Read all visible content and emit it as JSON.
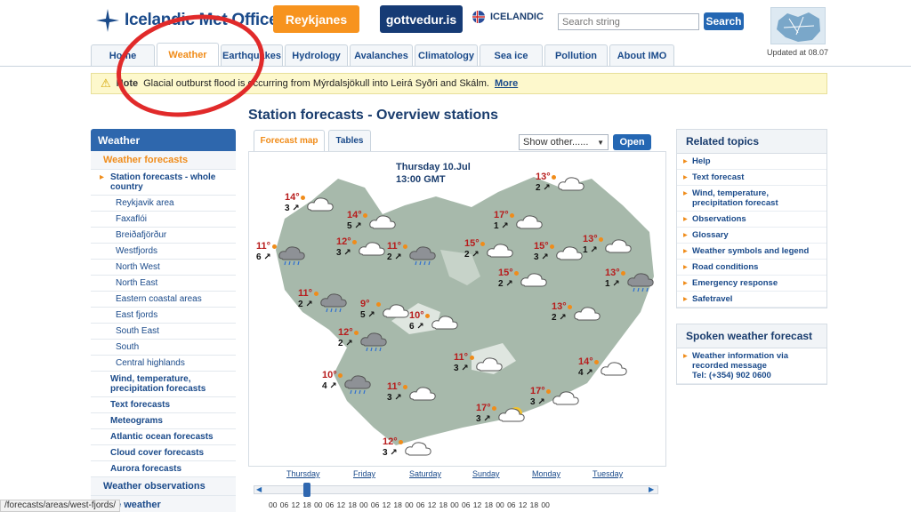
{
  "header": {
    "logo_text": "Icelandic Met Office",
    "btn_reykjanes": "Reykjanes",
    "btn_gottvedur": "gottvedur.is",
    "language": "ICELANDIC",
    "search_placeholder": "Search string",
    "search_button": "Search",
    "updated": "Updated at 08.07"
  },
  "nav": {
    "tabs": [
      "Home",
      "Weather",
      "Earthquakes",
      "Hydrology",
      "Avalanches",
      "Climatology",
      "Sea ice",
      "Pollution",
      "About IMO"
    ],
    "active": "Weather"
  },
  "alert": {
    "label": "Note",
    "text": "Glacial outburst flood is occurring from Mýrdalsjökull into Leirá Syðri and Skálm.",
    "link": "More"
  },
  "sidebar": {
    "head": "Weather",
    "section": "Weather forecasts",
    "first": "Station forecasts - whole country",
    "subs": [
      "Reykjavik area",
      "Faxaflói",
      "Breiðafjörður",
      "Westfjords",
      "North West",
      "North East",
      "Eastern coastal areas",
      "East fjords",
      "South East",
      "South",
      "Central highlands"
    ],
    "items": [
      "Wind, temperature, precipitation forecasts",
      "Text forecasts",
      "Meteograms",
      "Atlantic ocean forecasts",
      "Cloud cover forecasts",
      "Aurora forecasts"
    ],
    "observations": "Weather observations",
    "marine": "rine weather"
  },
  "main": {
    "title": "Station forecasts - Overview stations",
    "tab_map": "Forecast map",
    "tab_tables": "Tables",
    "select_value": "Show other......",
    "open_button": "Open",
    "date_line1": "Thursday 10.Jul",
    "date_line2": "13:00 GMT"
  },
  "stations": [
    {
      "t": "14°",
      "w": "3",
      "sym": "cloud"
    },
    {
      "t": "14°",
      "w": "5",
      "sym": "cloud"
    },
    {
      "t": "11°",
      "w": "6",
      "sym": "rain"
    },
    {
      "t": "12°",
      "w": "3",
      "sym": "cloud"
    },
    {
      "t": "11°",
      "w": "2",
      "sym": "rain"
    },
    {
      "t": "15°",
      "w": "2",
      "sym": "cloud"
    },
    {
      "t": "17°",
      "w": "1",
      "sym": "cloud"
    },
    {
      "t": "13°",
      "w": "2",
      "sym": "cloud"
    },
    {
      "t": "15°",
      "w": "3",
      "sym": "cloud"
    },
    {
      "t": "13°",
      "w": "1",
      "sym": "cloud"
    },
    {
      "t": "13°",
      "w": "1",
      "sym": "rain"
    },
    {
      "t": "11°",
      "w": "2",
      "sym": "rain"
    },
    {
      "t": "9°",
      "w": "5",
      "sym": "cloud"
    },
    {
      "t": "10°",
      "w": "6",
      "sym": "cloud"
    },
    {
      "t": "15°",
      "w": "2",
      "sym": "cloud"
    },
    {
      "t": "13°",
      "w": "2",
      "sym": "cloud"
    },
    {
      "t": "12°",
      "w": "2",
      "sym": "rain"
    },
    {
      "t": "11°",
      "w": "3",
      "sym": "cloud"
    },
    {
      "t": "10°",
      "w": "4",
      "sym": "rain"
    },
    {
      "t": "11°",
      "w": "3",
      "sym": "cloud"
    },
    {
      "t": "17°",
      "w": "3",
      "sym": "cloud"
    },
    {
      "t": "14°",
      "w": "4",
      "sym": "cloud"
    },
    {
      "t": "17°",
      "w": "3",
      "sym": "sun"
    },
    {
      "t": "12°",
      "w": "3",
      "sym": "cloud"
    }
  ],
  "timeline": {
    "days": [
      "Thursday",
      "Friday",
      "Saturday",
      "Sunday",
      "Monday",
      "Tuesday"
    ],
    "hours": [
      "00",
      "06",
      "12",
      "18",
      "00",
      "06",
      "12",
      "18",
      "00",
      "06",
      "12",
      "18",
      "00",
      "06",
      "12",
      "18",
      "00",
      "06",
      "12",
      "18",
      "00",
      "06",
      "12",
      "18",
      "00"
    ]
  },
  "related": {
    "head": "Related topics",
    "items": [
      "Help",
      "Text forecast",
      "Wind, temperature, precipitation forecast",
      "Observations",
      "Glossary",
      "Weather symbols and legend",
      "Road conditions",
      "Emergency response",
      "Safetravel"
    ]
  },
  "spoken": {
    "head": "Spoken weather forecast",
    "line1": "Weather information via recorded message",
    "line2": "Tel: (+354) 902 0600"
  },
  "statusbar": "/forecasts/areas/west-fjords/"
}
